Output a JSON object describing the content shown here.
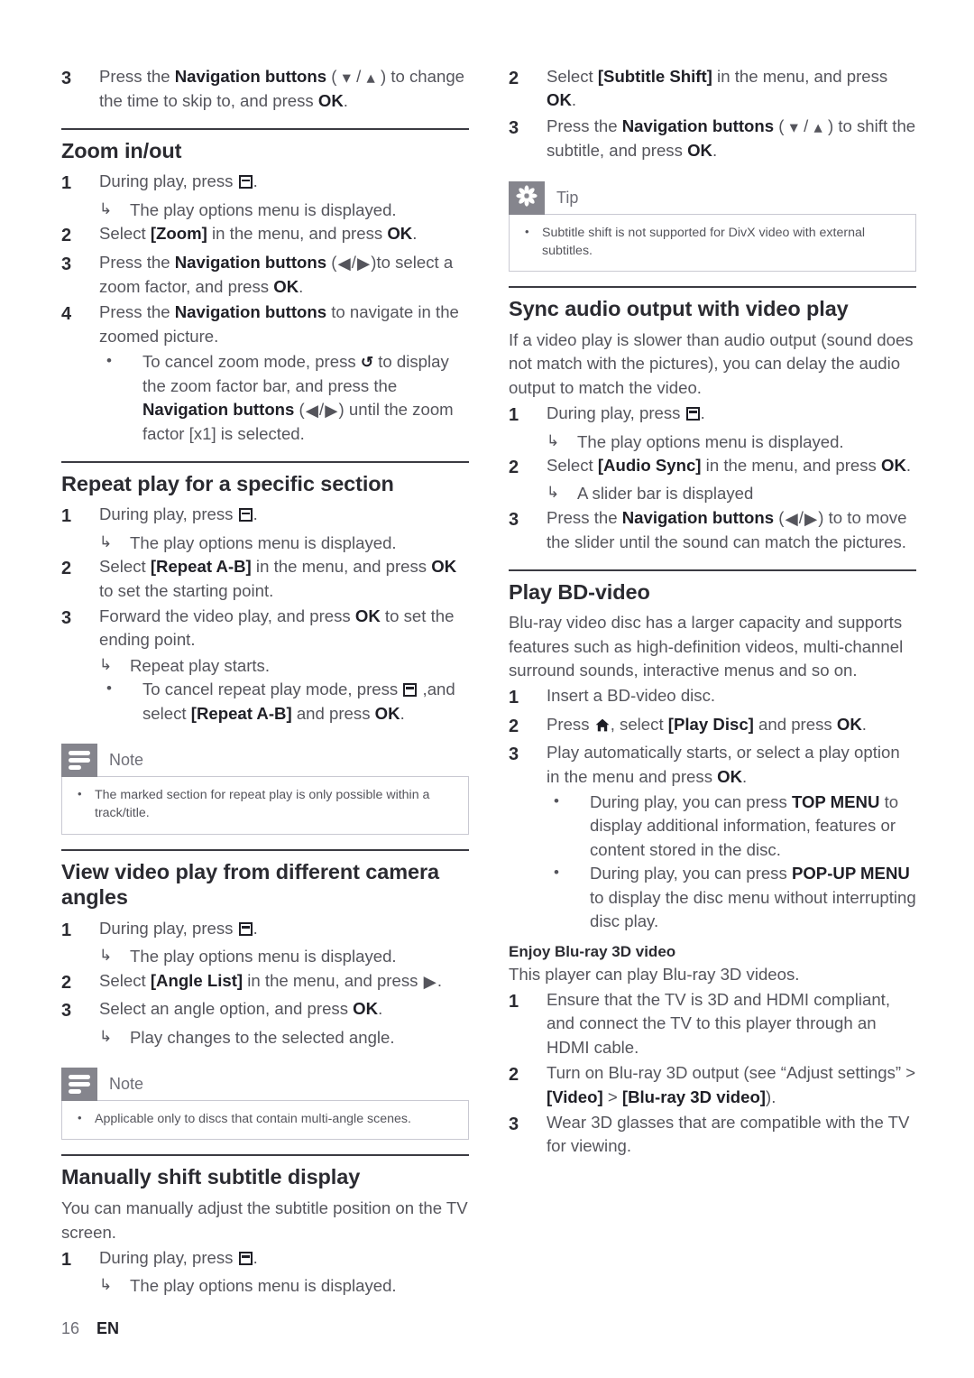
{
  "document": {
    "page_number": "16",
    "language_code": "EN"
  },
  "icons": {
    "options": "options-button-icon",
    "home": "home-button-icon",
    "back": "back-button-icon",
    "nav_up": "nav-up-arrow-icon",
    "nav_down": "nav-down-arrow-icon",
    "nav_left": "nav-left-arrow-icon",
    "nav_right": "nav-right-arrow-icon",
    "note": "note-icon",
    "tip": "tip-icon",
    "result_arrow": "result-arrow-icon",
    "bullet": "bullet-icon"
  },
  "left_column": {
    "top_step": {
      "num": "3",
      "html": "Press the <b>Navigation buttons</b> ( <span class=\"nav-arrow\">&#9662;</span> / <span class=\"nav-arrow\">&#9652;</span> ) to change the time to skip to, and press <b>OK</b>."
    },
    "sections": [
      {
        "title": "Zoom in/out",
        "steps": [
          {
            "num": "1",
            "html": "During play, press <span class=\"ico ico-options\"></span>."
          },
          {
            "type": "result",
            "html": "The play options menu is displayed."
          },
          {
            "num": "2",
            "html": "Select <b>[Zoom]</b> in the menu, and press <b>OK</b>."
          },
          {
            "num": "3",
            "html": "Press the <b>Navigation buttons</b> (<span class=\"nav-arrow\">&#9664;</span>/<span class=\"nav-arrow\">&#9654;</span>)to select a zoom factor, and press <b>OK</b>."
          },
          {
            "num": "4",
            "html": "Press the <b>Navigation buttons</b> to navigate in the zoomed picture."
          },
          {
            "type": "bullet",
            "html": "To cancel zoom mode, press <span class=\"ico-back\">&#8634;</span> to display the zoom factor bar, and press the <b>Navigation buttons</b> (<span class=\"nav-arrow\">&#9664;</span>/<span class=\"nav-arrow\">&#9654;</span>) until the zoom factor [x1] is selected."
          }
        ]
      },
      {
        "title": "Repeat play for a specific section",
        "steps": [
          {
            "num": "1",
            "html": "During play, press <span class=\"ico ico-options\"></span>."
          },
          {
            "type": "result",
            "html": "The play options menu is displayed."
          },
          {
            "num": "2",
            "html": "Select <b>[Repeat A-B]</b> in the menu, and press <b>OK</b> to set the starting point."
          },
          {
            "num": "3",
            "html": "Forward the video play, and press <b>OK</b> to set the ending point."
          },
          {
            "type": "result",
            "html": "Repeat play starts."
          },
          {
            "type": "bullet",
            "html": "To cancel repeat play mode, press <span class=\"ico ico-options\"></span> ,and select <b>[Repeat A-B]</b> and press <b>OK</b>."
          }
        ],
        "callout": {
          "kind": "note",
          "title": "Note",
          "items": [
            "The marked section for repeat play is only possible within a track/title."
          ]
        }
      },
      {
        "title": "View video play from different camera angles",
        "steps": [
          {
            "num": "1",
            "html": "During play, press <span class=\"ico ico-options\"></span>."
          },
          {
            "type": "result",
            "html": "The play options menu is displayed."
          },
          {
            "num": "2",
            "html": "Select <b>[Angle List]</b> in the menu, and press <span class=\"nav-arrow\">&#9654;</span>."
          },
          {
            "num": "3",
            "html": "Select an angle option, and press <b>OK</b>."
          },
          {
            "type": "result",
            "html": "Play changes to the selected angle."
          }
        ],
        "callout": {
          "kind": "note",
          "title": "Note",
          "items": [
            "Applicable only to discs that contain multi-angle scenes."
          ]
        }
      },
      {
        "title": "Manually shift subtitle display",
        "paragraphs": [
          "You can manually adjust the subtitle position on the TV screen."
        ],
        "steps": [
          {
            "num": "1",
            "html": "During play, press <span class=\"ico ico-options\"></span>."
          },
          {
            "type": "result",
            "html": "The play options menu is displayed."
          }
        ]
      }
    ]
  },
  "right_column": {
    "top_steps": [
      {
        "num": "2",
        "html": "Select <b>[Subtitle Shift]</b> in the menu, and press <b>OK</b>."
      },
      {
        "num": "3",
        "html": "Press the <b>Navigation buttons</b> ( <span class=\"nav-arrow\">&#9662;</span> / <span class=\"nav-arrow\">&#9652;</span> ) to shift the subtitle, and press <b>OK</b>."
      }
    ],
    "top_callout": {
      "kind": "tip",
      "title": "Tip",
      "items": [
        "Subtitle shift is not supported for DivX video with external subtitles."
      ]
    },
    "sections": [
      {
        "title": "Sync audio output with video play",
        "paragraphs": [
          "If a video play is slower than audio output (sound does not match with the pictures), you can delay the audio output to match the video."
        ],
        "steps": [
          {
            "num": "1",
            "html": "During play, press <span class=\"ico ico-options\"></span>."
          },
          {
            "type": "result",
            "html": "The play options menu is displayed."
          },
          {
            "num": "2",
            "html": "Select <b>[Audio Sync]</b> in the menu, and press <b>OK</b>."
          },
          {
            "type": "result",
            "html": "A slider bar is displayed"
          },
          {
            "num": "3",
            "html": "Press the <b>Navigation buttons</b> (<span class=\"nav-arrow\">&#9664;</span>/<span class=\"nav-arrow\">&#9654;</span>) to to move the slider until the sound can match the pictures."
          }
        ]
      },
      {
        "title": "Play BD-video",
        "paragraphs": [
          "Blu-ray video disc has a larger capacity and supports features such as high-definition videos, multi-channel surround sounds, interactive menus and so on."
        ],
        "steps": [
          {
            "num": "1",
            "html": "Insert a BD-video disc."
          },
          {
            "num": "2",
            "html": "Press <span class=\"ico ico-home\"></span>, select <b>[Play Disc]</b> and press <b>OK</b>."
          },
          {
            "num": "3",
            "html": "Play automatically starts, or select a play option in the menu and press <b>OK</b>."
          },
          {
            "type": "bullet",
            "html": "During play, you can press <b>TOP MENU</b> to display additional information, features or content stored in the disc."
          },
          {
            "type": "bullet",
            "html": "During play, you can press <b>POP-UP MENU</b> to display the disc menu without interrupting disc play."
          }
        ],
        "subsection": {
          "title": "Enjoy Blu-ray 3D video",
          "paragraphs": [
            "This player can play Blu-ray 3D videos."
          ],
          "steps": [
            {
              "num": "1",
              "html": "Ensure that the TV is 3D and HDMI compliant, and connect the TV to this player through an HDMI cable."
            },
            {
              "num": "2",
              "html": "Turn on Blu-ray 3D output (see “Adjust settings” > <b>[Video]</b> > <b>[Blu-ray 3D video]</b>)."
            },
            {
              "num": "3",
              "html": "Wear 3D glasses that are compatible with the TV for viewing."
            }
          ]
        }
      }
    ]
  }
}
